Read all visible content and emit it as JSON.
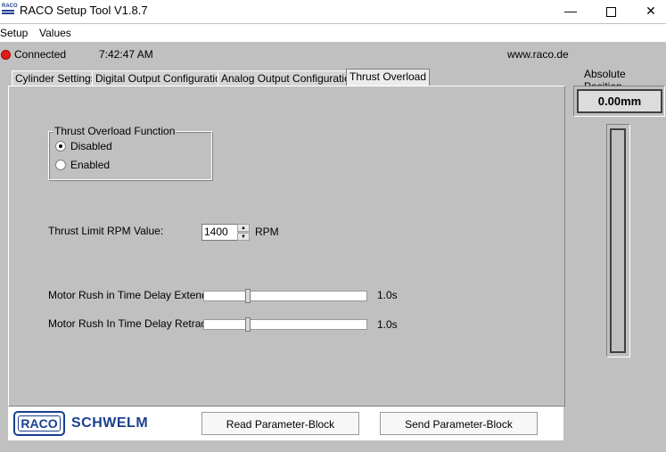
{
  "window": {
    "title": "RACO Setup Tool  V1.8.7",
    "minimize_glyph": "—",
    "close_glyph": "✕"
  },
  "menu": {
    "items": [
      {
        "label": "Setup"
      },
      {
        "label": "Values"
      }
    ]
  },
  "status": {
    "connection": "Connected",
    "time": "7:42:47 AM",
    "url": "www.raco.de",
    "indicator_color": "#e41b1b"
  },
  "tabs": [
    {
      "label": "Cylinder Settings",
      "active": false
    },
    {
      "label": "Digital Output Configuration",
      "active": false
    },
    {
      "label": "Analog Output Configuration",
      "active": false
    },
    {
      "label": "Thrust Overload",
      "active": true
    }
  ],
  "thrust_overload": {
    "group_title": "Thrust Overload Function",
    "options": [
      {
        "label": "Disabled",
        "checked": true
      },
      {
        "label": "Enabled",
        "checked": false
      }
    ],
    "rpm_label": "Thrust Limit RPM Value:",
    "rpm_value": "1400",
    "rpm_unit": "RPM",
    "extend": {
      "label": "Motor Rush in Time Delay Extend:",
      "value": "1.0s",
      "level": 0.27
    },
    "retract": {
      "label": "Motor Rush In Time Delay Retract:",
      "value": "1.0s",
      "level": 0.27
    }
  },
  "bottom": {
    "logo_text": "RACO",
    "brand_text": "SCHWELM",
    "read_button": "Read Parameter-Block",
    "send_button": "Send Parameter-Block"
  },
  "position": {
    "label": "Absolute Position",
    "value": "0.00mm"
  },
  "icons": {
    "app_icon": "raco-app-icon",
    "status": "status-dot-icon",
    "spin_up": "spin-up-arrow-icon",
    "spin_down": "spin-down-arrow-icon"
  }
}
